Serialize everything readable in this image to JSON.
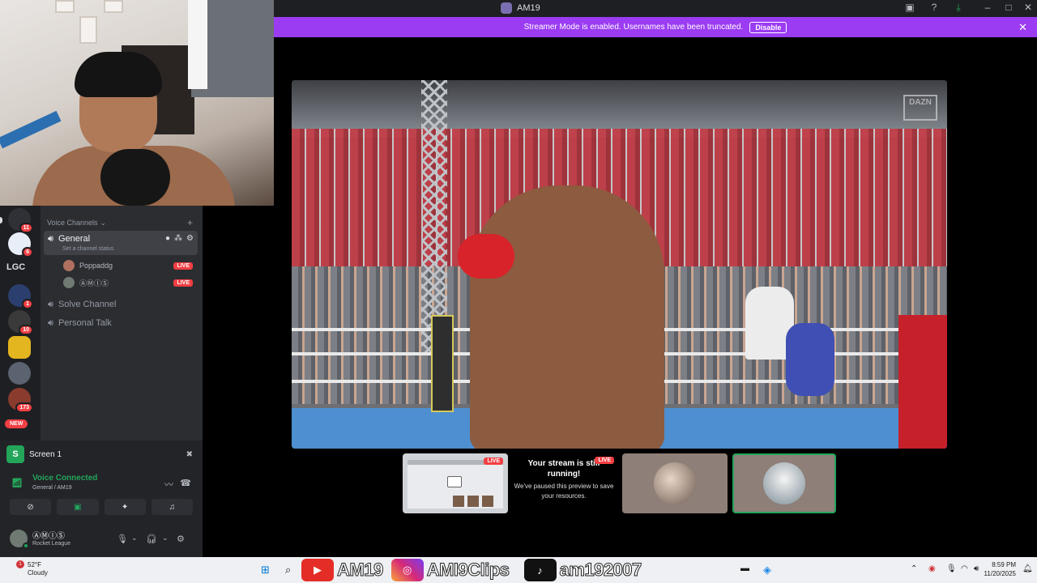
{
  "window": {
    "title": "AM19"
  },
  "colors": {
    "accent": "#9b3cf2",
    "live": "#f23f43",
    "connected": "#23a55a",
    "sidebar": "#2b2d31",
    "rail": "#1e1f22"
  },
  "banner": {
    "text": "Streamer Mode is enabled. Usernames have been truncated.",
    "disable_label": "Disable"
  },
  "rail": {
    "label_lgc": "LGC",
    "new_label": "NEW",
    "servers": [
      {
        "badge": "11"
      },
      {
        "badge": "6"
      },
      {
        "badge": "1"
      },
      {
        "badge": "10"
      },
      {
        "badge": ""
      },
      {
        "badge": ""
      },
      {
        "badge": "173"
      }
    ]
  },
  "channels": {
    "category": "Voice Channels",
    "general": {
      "name": "General",
      "status": "Set a channel status"
    },
    "members": [
      {
        "name": "Poppaddg",
        "live": "LIVE"
      },
      {
        "name": "ⒶⓂⒾⓈ",
        "live": "LIVE"
      }
    ],
    "others": [
      {
        "name": "Solve Channel"
      },
      {
        "name": "Personal Talk"
      }
    ]
  },
  "panel": {
    "screen_label": "Screen 1",
    "voice_status": "Voice Connected",
    "voice_channel": "General / AM19",
    "user_name": "ⒶⓂⒾⓈ",
    "user_activity": "Rocket League"
  },
  "stream": {
    "live_label": "LIVE",
    "paused_title": "Your stream is still running!",
    "paused_sub": "We've paused this preview to save your resources.",
    "watermark": "DAZN"
  },
  "taskbar": {
    "alert_count": "1",
    "temp": "52°F",
    "condition": "Cloudy",
    "socials": [
      {
        "icon": "youtube-icon",
        "text": "AM19"
      },
      {
        "icon": "instagram-icon",
        "text": "AMI9Clips"
      },
      {
        "icon": "tiktok-icon",
        "text": "am192007"
      }
    ],
    "time": "8:59 PM",
    "date": "11/20/2025"
  }
}
